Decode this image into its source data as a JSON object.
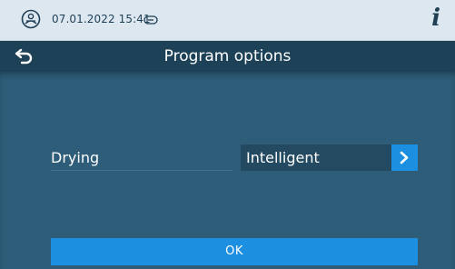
{
  "status_bar": {
    "datetime": "07.01.2022 15:41",
    "logo_icon": "device-logo-icon",
    "card_icon": "card-icon",
    "info_label": "i"
  },
  "title_bar": {
    "back_icon": "back-arrow-icon",
    "title": "Program options"
  },
  "options": [
    {
      "label": "Drying",
      "value": "Intelligent",
      "action_icon": "chevron-right-icon"
    }
  ],
  "ok_button": {
    "label": "OK"
  },
  "colors": {
    "status_bar_bg": "#dde7f0",
    "title_bar_bg": "#1d4258",
    "content_bg": "#2d5d78",
    "accent": "#1c8fe0"
  }
}
